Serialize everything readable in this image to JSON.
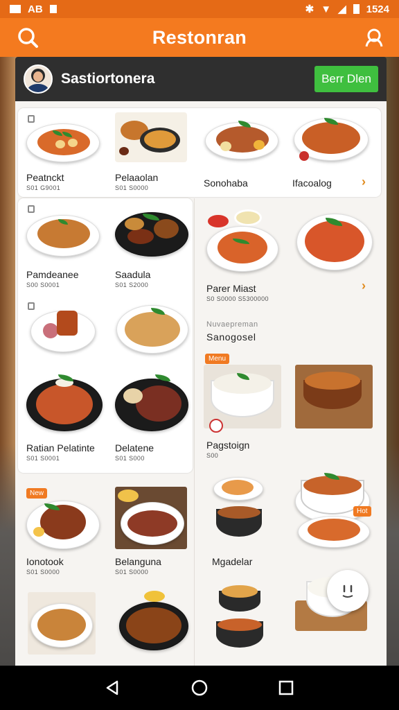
{
  "status_bar": {
    "left_text": "AB",
    "time": "1524"
  },
  "app_bar": {
    "title": "Restonran"
  },
  "account": {
    "name": "Sastiortonera",
    "order_button": "Berr Dlen"
  },
  "colors": {
    "accent": "#f47a1f",
    "status_bar": "#e56a16",
    "order_button": "#3fbf3f",
    "tag": "#f07a22"
  },
  "sections": {
    "section_label": "Nuvaepreman",
    "section_title": "Sanogosel"
  },
  "tags": {
    "menu": "Menu",
    "new": "New",
    "hot": "Hot"
  },
  "items": [
    {
      "name": "Peatnckt",
      "price": "S01 G9001"
    },
    {
      "name": "Pelaaolan",
      "price": "S01 S0000"
    },
    {
      "name": "Sonohaba"
    },
    {
      "name": "Ifacoalog"
    },
    {
      "name": "Pamdeanee",
      "price": "S00 S0001"
    },
    {
      "name": "Saadula",
      "price": "S01 S2000"
    },
    {
      "name": "Parer Miast",
      "price": "S0 S0000 S5300000"
    },
    {
      "name": "Ratian Pelatinte",
      "price": "S01 S0001"
    },
    {
      "name": "Delatene",
      "price": "S01 S000"
    },
    {
      "name": "Pagstoign",
      "price": "S00"
    },
    {
      "name": "Ionotook",
      "price": "S01 S0000"
    },
    {
      "name": "Belanguna",
      "price": "S01 S0000"
    },
    {
      "name": "Mgadelar"
    }
  ],
  "icons": [
    "search-icon",
    "user-icon",
    "avatar",
    "chevron-right-icon",
    "chat-icon",
    "back-icon",
    "home-icon",
    "recents-icon"
  ]
}
